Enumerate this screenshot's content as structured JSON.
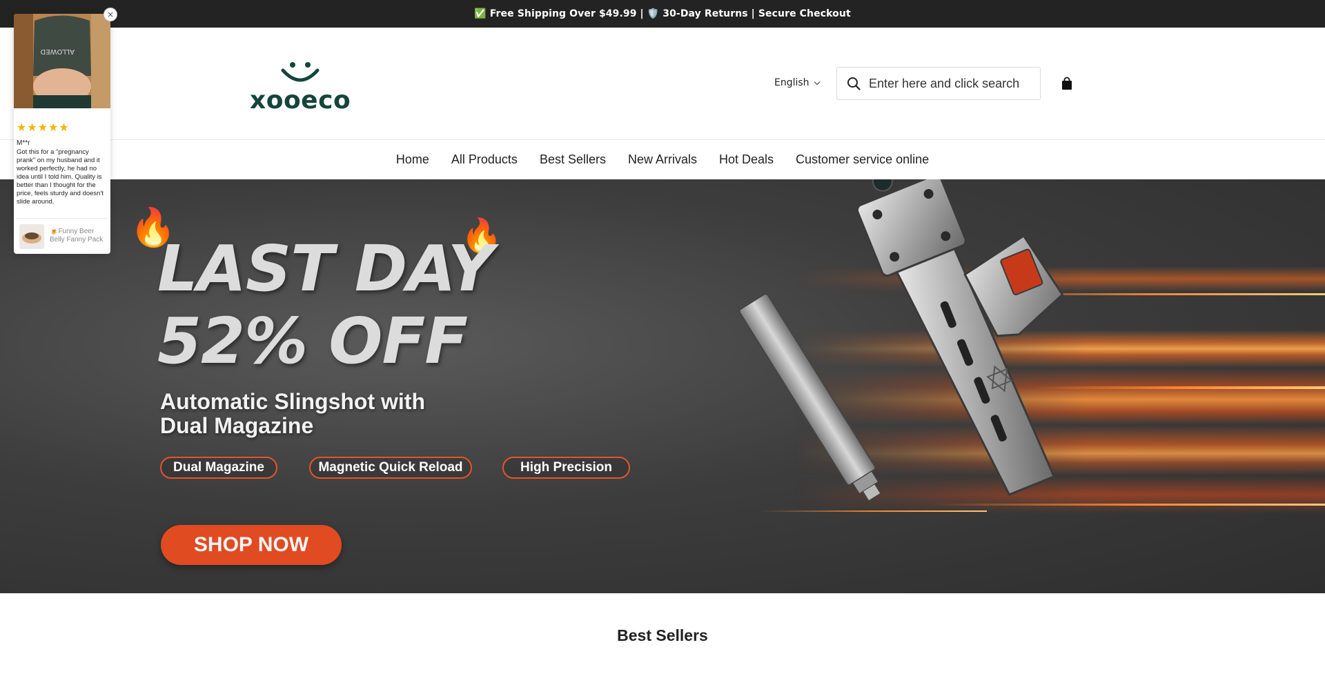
{
  "announcement": {
    "text": "✅ Free Shipping Over $49.99 | 🛡️ 30-Day Returns | Secure Checkout"
  },
  "header": {
    "logo_text": "xooeco",
    "language": "English",
    "search_placeholder": "Enter here and click search",
    "brand_color": "#15453a"
  },
  "nav": {
    "items": [
      {
        "label": "Home"
      },
      {
        "label": "All Products"
      },
      {
        "label": "Best Sellers"
      },
      {
        "label": "New Arrivals"
      },
      {
        "label": "Hot Deals"
      },
      {
        "label": "Customer service online"
      }
    ]
  },
  "hero": {
    "title_line1": "LAST DAY",
    "title_line2": "52% OFF",
    "flame_icon": "🔥",
    "subtitle_line1": "Automatic Slingshot with",
    "subtitle_line2": "Dual Magazine",
    "features": [
      "Dual Magazine",
      "Magnetic Quick Reload",
      "High Precision"
    ],
    "cta": "SHOP NOW",
    "accent_color": "#e04b22"
  },
  "sections": {
    "best_sellers_title": "Best Sellers"
  },
  "review_popup": {
    "rating": 5,
    "stars": "★★★★★",
    "reviewer": "M**r",
    "text": "Got this for a \"pregnancy prank\" on my husband and it worked perfectly, he had no idea until I told him. Quality is better than I thought for the price, feels sturdy and doesn't slide around.",
    "product_name": "🍺Funny Beer Belly Fanny Pack",
    "close_label": "×"
  }
}
